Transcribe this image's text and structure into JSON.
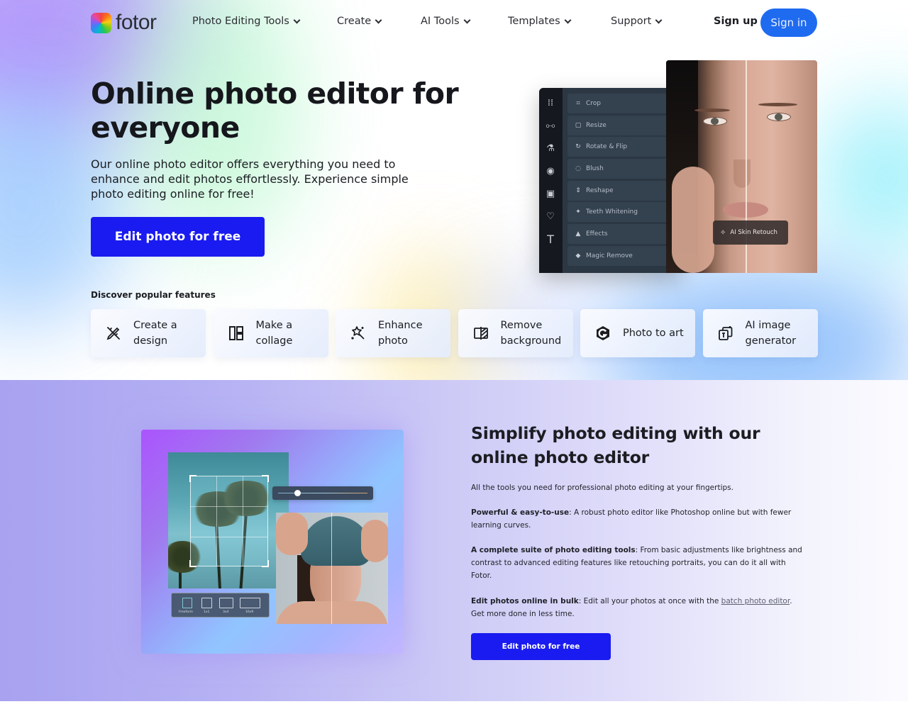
{
  "nav": {
    "logo_text": "fotor",
    "items": [
      {
        "label": "Photo Editing Tools"
      },
      {
        "label": "Create"
      },
      {
        "label": "AI Tools"
      },
      {
        "label": "Templates"
      },
      {
        "label": "Support"
      }
    ],
    "sign_up": "Sign up",
    "sign_in": "Sign in"
  },
  "hero": {
    "title": "Online photo editor for everyone",
    "description": "Our online photo editor offers everything you need to enhance and edit photos effortlessly. Experience simple photo editing online for free!",
    "cta": "Edit photo for free"
  },
  "editor_mockup": {
    "rail_icons": [
      "grid-icon",
      "sliders-icon",
      "flask-icon",
      "eye-icon",
      "frame-icon",
      "shapes-icon",
      "text-icon"
    ],
    "tools": [
      {
        "icon": "crop-icon",
        "glyph": "⌗",
        "label": "Crop"
      },
      {
        "icon": "resize-icon",
        "glyph": "▢",
        "label": "Resize"
      },
      {
        "icon": "rotate-icon",
        "glyph": "↻",
        "label": "Rotate & Flip"
      },
      {
        "icon": "blush-icon",
        "glyph": "◌",
        "label": "Blush"
      },
      {
        "icon": "reshape-icon",
        "glyph": "⇕",
        "label": "Reshape"
      },
      {
        "icon": "teeth-icon",
        "glyph": "✦",
        "label": "Teeth Whitening"
      },
      {
        "icon": "effects-icon",
        "glyph": "▲",
        "label": "Effects"
      },
      {
        "icon": "eraser-icon",
        "glyph": "◆",
        "label": "Magic Remove"
      }
    ],
    "badge": "AI Skin Retouch"
  },
  "features": {
    "heading": "Discover popular features",
    "items": [
      {
        "label": "Create a design",
        "icon": "pencil-ruler-icon"
      },
      {
        "label": "Make a collage",
        "icon": "collage-layout-icon"
      },
      {
        "label": "Enhance photo",
        "icon": "magic-wand-icon"
      },
      {
        "label": "Remove background",
        "icon": "remove-background-icon"
      },
      {
        "label": "Photo to art",
        "icon": "art-hexagon-icon"
      },
      {
        "label": "AI image generator",
        "icon": "ai-image-icon"
      }
    ]
  },
  "section2": {
    "title": "Simplify photo editing with our online photo editor",
    "intro": "All the tools you need for professional photo editing at your fingertips.",
    "points": [
      {
        "bold": "Powerful & easy-to-use",
        "text": ": A robust photo editor like Photoshop online but with fewer learning curves."
      },
      {
        "bold": "A complete suite of photo editing tools",
        "text": ": From basic adjustments like brightness and contrast to advanced editing features like retouching portraits, you can do it all with Fotor."
      },
      {
        "bold": "Edit photos online in bulk",
        "text": ": Edit all your photos at once with the ",
        "link": "batch photo editor",
        "after": ". Get more done in less time."
      }
    ],
    "cta": "Edit photo for free",
    "mockup_ratios": [
      "Freeform",
      "1x1",
      "3x4",
      "16x9"
    ]
  },
  "colors": {
    "primary_cta": "#1a1bf0",
    "sign_in": "#1f6bf0"
  }
}
